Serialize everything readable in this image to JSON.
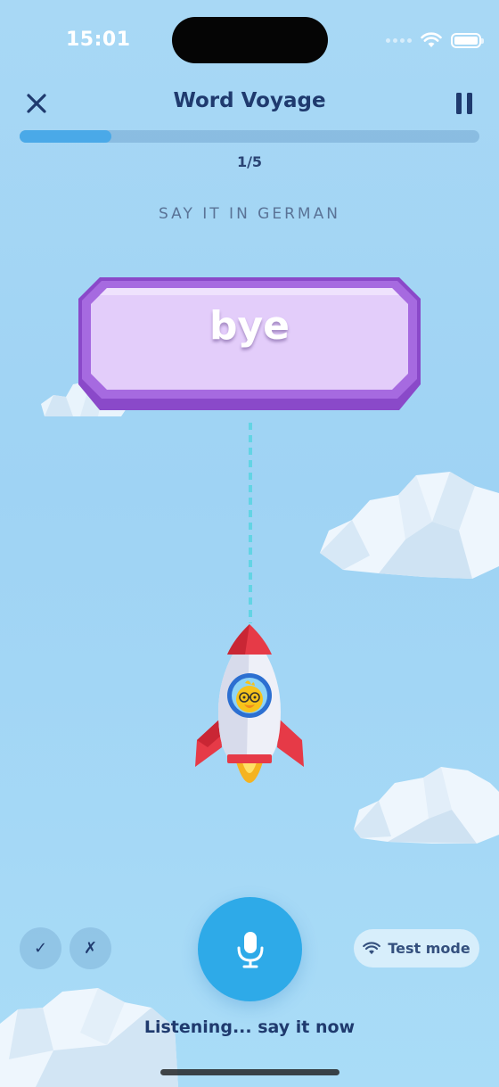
{
  "status_bar": {
    "time": "15:01"
  },
  "header": {
    "title": "Word Voyage"
  },
  "progress": {
    "label": "1/5",
    "fraction": 0.2
  },
  "prompt": {
    "instruction": "SAY IT IN GERMAN",
    "word": "bye"
  },
  "controls": {
    "check_symbol": "✓",
    "x_symbol": "✗",
    "test_mode_label": "Test mode",
    "status_text": "Listening... say it now"
  },
  "colors": {
    "accent": "#2eaae8",
    "card": "#e3cdfa",
    "card_border": "#9b5fd6",
    "text_dark": "#1f3a6e"
  },
  "icons": [
    "close-icon",
    "pause-icon",
    "microphone-icon",
    "wifi-icon",
    "battery-icon",
    "duck-pilot-icon"
  ]
}
